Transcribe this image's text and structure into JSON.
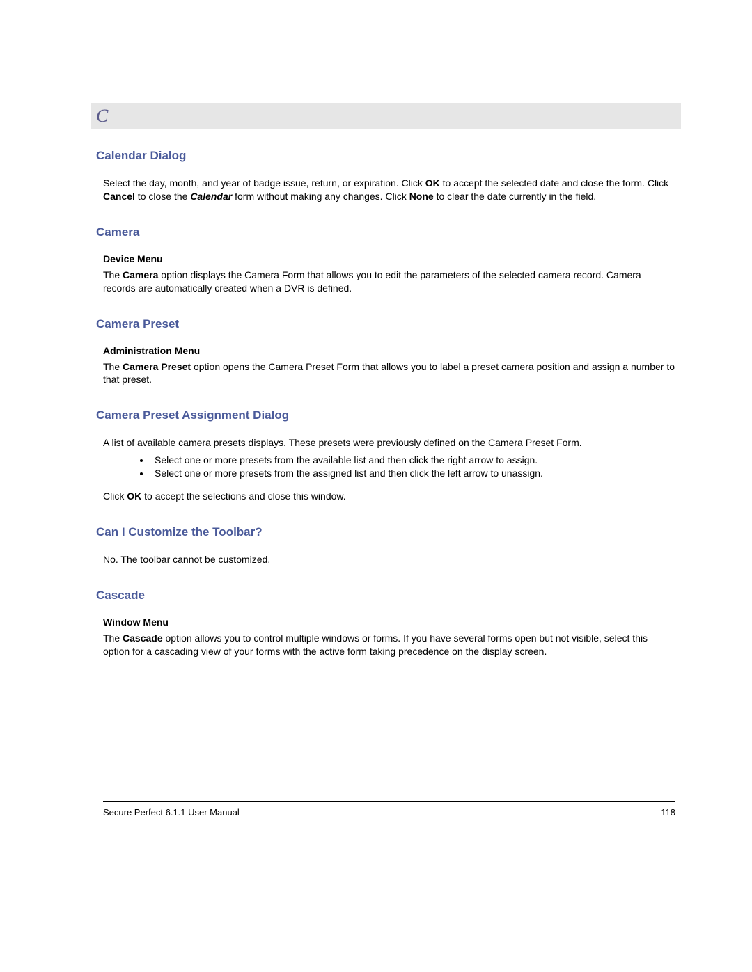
{
  "sectionLetter": "C",
  "sections": {
    "calendarDialog": {
      "heading": "Calendar Dialog",
      "p1_a": "Select the day, month, and year of badge issue, return, or expiration. Click ",
      "p1_ok": "OK",
      "p1_b": " to accept the selected date and close the form. Click ",
      "p1_cancel": "Cancel",
      "p1_c": " to close the ",
      "p1_cal": "Calendar",
      "p1_d": " form without making any changes. Click ",
      "p1_none": "None",
      "p1_e": " to clear the date currently in the field."
    },
    "camera": {
      "heading": "Camera",
      "sub": "Device Menu",
      "p1_a": "The ",
      "p1_bold": "Camera",
      "p1_b": " option displays the Camera Form that allows you to edit the parameters of the selected camera record. Camera records are automatically created when a DVR is defined."
    },
    "cameraPreset": {
      "heading": "Camera Preset",
      "sub": "Administration Menu",
      "p1_a": "The ",
      "p1_bold": "Camera Preset",
      "p1_b": " option opens the Camera Preset Form that allows you to label a preset camera position and assign a number to that preset."
    },
    "cameraPresetAssignment": {
      "heading": "Camera Preset Assignment Dialog",
      "p1": "A list of available camera presets displays. These presets were previously defined on the Camera Preset Form.",
      "bullets": [
        "Select one or more presets from the available list and then click the right arrow to assign.",
        "Select one or more presets from the assigned list and then click the left arrow to unassign."
      ],
      "p2_a": "Click ",
      "p2_ok": "OK",
      "p2_b": " to accept the selections and close this window."
    },
    "customize": {
      "heading": "Can I Customize the Toolbar?",
      "p1": "No. The toolbar cannot be customized."
    },
    "cascade": {
      "heading": "Cascade",
      "sub": "Window Menu",
      "p1_a": "The ",
      "p1_bold": "Cascade",
      "p1_b": " option allows you to control multiple windows or forms. If you have several forms open but not visible, select this option for a cascading view of your forms with the active form taking precedence on the display screen."
    }
  },
  "footer": {
    "left": "Secure Perfect 6.1.1 User Manual",
    "right": "118"
  }
}
